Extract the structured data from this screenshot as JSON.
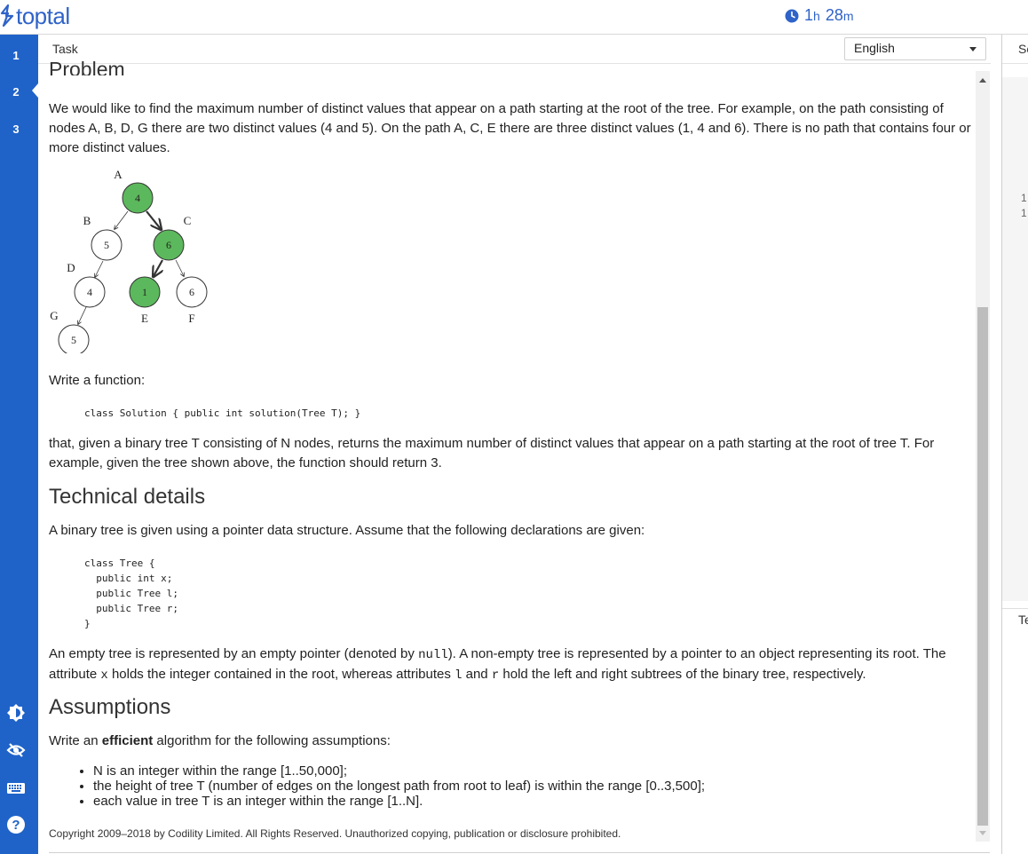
{
  "header": {
    "brand": "toptal",
    "timer": {
      "hours": "1",
      "hours_unit": "h",
      "minutes": "28",
      "minutes_unit": "m"
    }
  },
  "nav": {
    "items": [
      {
        "label": "1",
        "active": false
      },
      {
        "label": "2",
        "active": true
      },
      {
        "label": "3",
        "active": false
      }
    ],
    "tools": [
      "brightness-icon",
      "eye-icon",
      "keyboard-icon",
      "help-icon"
    ]
  },
  "task_panel": {
    "tab_label": "Task",
    "language": "English",
    "problem_title": "Problem",
    "intro": "We would like to find the maximum number of distinct values that appear on a path starting at the root of the tree. For example, on the path consisting of nodes A, B, D, G there are two distinct values (4 and 5). On the path A, C, E there are three distinct values (1, 4 and 6). There is no path that contains four or more distinct values.",
    "tree": {
      "nodes": [
        {
          "id": "A",
          "value": "4",
          "highlight": true
        },
        {
          "id": "B",
          "value": "5",
          "highlight": false
        },
        {
          "id": "C",
          "value": "6",
          "highlight": true
        },
        {
          "id": "D",
          "value": "4",
          "highlight": false
        },
        {
          "id": "E",
          "value": "1",
          "highlight": true
        },
        {
          "id": "F",
          "value": "6",
          "highlight": false
        },
        {
          "id": "G",
          "value": "5",
          "highlight": false
        }
      ],
      "highlight_color": "#5cb85c"
    },
    "write_fn": "Write a function:",
    "signature": "class Solution { public int solution(Tree T); }",
    "returns": "that, given a binary tree T consisting of N nodes, returns the maximum number of distinct values that appear on a path starting at the root of tree T. For example, given the tree shown above, the function should return 3.",
    "tech_title": "Technical details",
    "tech_intro": "A binary tree is given using a pointer data structure. Assume that the following declarations are given:",
    "tree_class": "class Tree {\n  public int x;\n  public Tree l;\n  public Tree r;\n}",
    "empty_a": "An empty tree is represented by an empty pointer (denoted by ",
    "null_kw": "null",
    "empty_b": "). A non-empty tree is represented by a pointer to an object representing its root. The attribute ",
    "x_kw": "x",
    "empty_c": " holds the integer contained in the root, whereas attributes ",
    "l_kw": "l",
    "empty_d": " and ",
    "r_kw": "r",
    "empty_e": " hold the left and right subtrees of the binary tree, respectively.",
    "assump_title": "Assumptions",
    "assump_pre": "Write an ",
    "assump_bold": "efficient",
    "assump_post": " algorithm for the following assumptions:",
    "assumptions": [
      "N is an integer within the range [1..50,000];",
      "the height of tree T (number of edges on the longest path from root to leaf) is within the range [0..3,500];",
      "each value in tree T is an integer within the range [1..N]."
    ],
    "copyright": "Copyright 2009–2018 by Codility Limited. All Rights Reserved. Unauthorized copying, publication or disclosure prohibited."
  },
  "right_panel": {
    "tab_label": "Sc",
    "line_numbers": [
      "1",
      "1"
    ],
    "bottom_label": "Te"
  },
  "colors": {
    "brand": "#2f63c9",
    "nav_bg": "#1f63c9"
  }
}
